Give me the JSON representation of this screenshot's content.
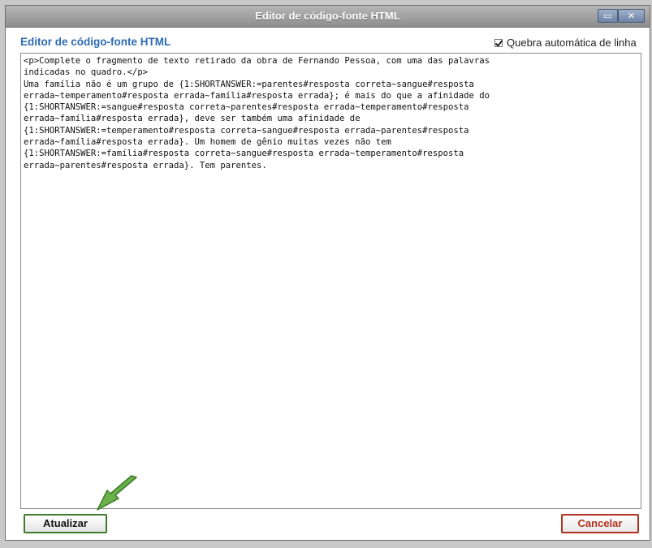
{
  "window": {
    "title": "Editor de código-fonte HTML",
    "maximize_label": "▭",
    "close_label": "✕"
  },
  "editor": {
    "heading": "Editor de código-fonte HTML",
    "wrap_label": "Quebra automática de linha",
    "wrap_checked": true,
    "content": "<p>Complete o fragmento de texto retirado da obra de Fernando Pessoa, com uma das palavras\nindicadas no quadro.</p>\nUma família não é um grupo de {1:SHORTANSWER:=parentes#resposta correta~sangue#resposta\nerrada~temperamento#resposta errada~família#resposta errada}; é mais do que a afinidade do\n{1:SHORTANSWER:=sangue#resposta correta~parentes#resposta errada~temperamento#resposta\nerrada~família#resposta errada}, deve ser também uma afinidade de\n{1:SHORTANSWER:=temperamento#resposta correta~sangue#resposta errada~parentes#resposta\nerrada~família#resposta errada}. Um homem de gênio muitas vezes não tem\n{1:SHORTANSWER:=família#resposta correta~sangue#resposta errada~temperamento#resposta\nerrada~parentes#resposta errada}. Tem parentes."
  },
  "buttons": {
    "update": "Atualizar",
    "cancel": "Cancelar"
  },
  "colors": {
    "heading": "#2e6bb3",
    "update_border": "#3e7b2a",
    "cancel_border": "#b2311f",
    "arrow": "#6ab04c"
  },
  "icons": {
    "pointer": "green-arrow-icon",
    "checkbox": "checkmark-icon"
  }
}
